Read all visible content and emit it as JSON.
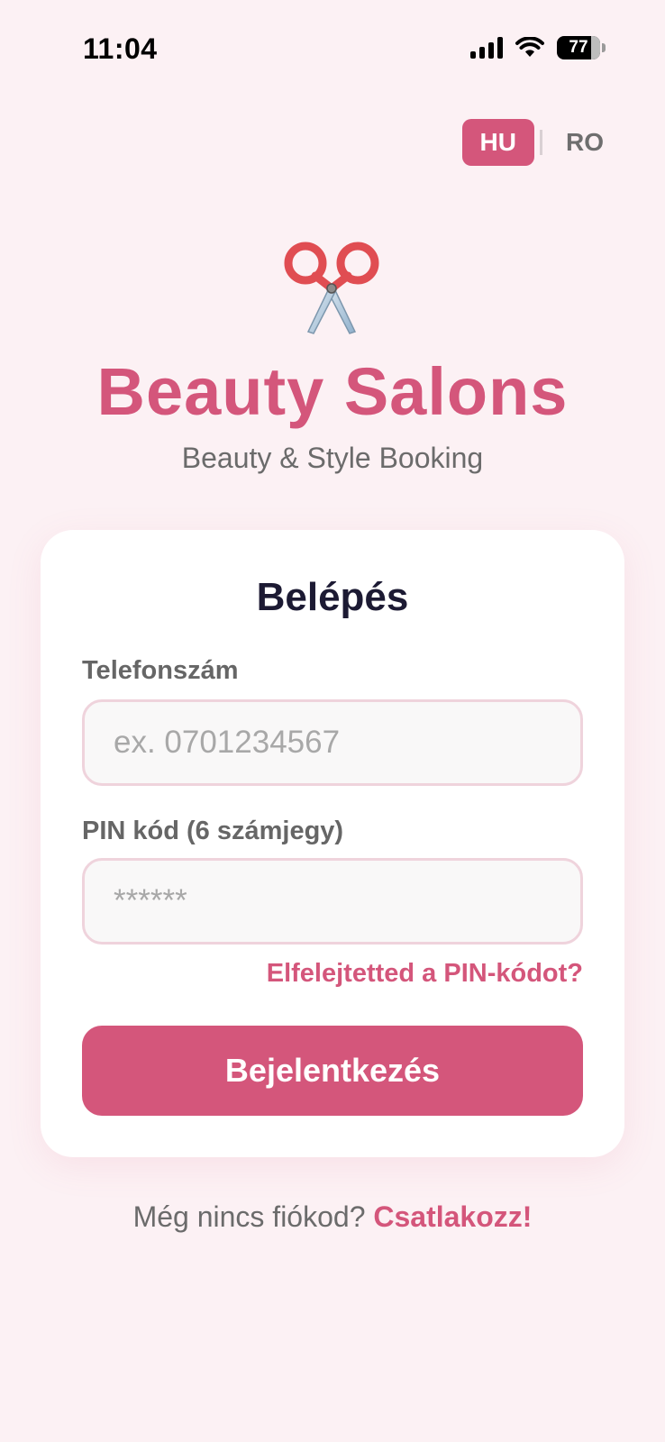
{
  "status_bar": {
    "time": "11:04",
    "battery_level": "77",
    "icons": [
      "signal-icon",
      "wifi-icon",
      "battery-icon"
    ]
  },
  "language": {
    "options": [
      "HU",
      "RO"
    ],
    "selected": "HU"
  },
  "brand": {
    "logo_icon": "scissors-icon",
    "title": "Beauty Salons",
    "subtitle": "Beauty & Style Booking"
  },
  "login": {
    "title": "Belépés",
    "phone_label": "Telefonszám",
    "phone_value": "",
    "phone_placeholder": "ex. 0701234567",
    "pin_label": "PIN kód (6 számjegy)",
    "pin_value": "",
    "pin_placeholder": "******",
    "forgot_link": "Elfelejtetted a PIN-kódot?",
    "submit_label": "Bejelentkezés"
  },
  "signup": {
    "prompt": "Még nincs fiókod?",
    "link": "Csatlakozz!"
  },
  "colors": {
    "background": "#fcf1f4",
    "accent": "#d4567b",
    "title_text": "#1c1a33",
    "muted_text": "#6b6b6b",
    "input_border": "#efd3dc"
  }
}
